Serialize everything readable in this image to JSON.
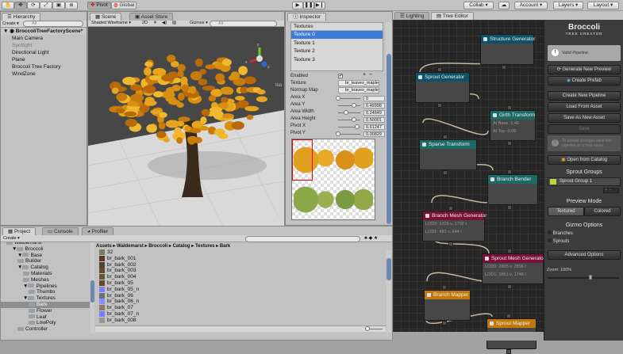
{
  "toolbar": {
    "tools": [
      "hand-tool",
      "move-tool",
      "rotate-tool",
      "scale-tool",
      "rect-tool",
      "transform-tool"
    ],
    "pivot": "Pivot",
    "global": "Global",
    "collab": "Collab ▾",
    "account": "Account ▾",
    "layers": "Layers ▾",
    "layout": "Layout ▾"
  },
  "hierarchy": {
    "tab": "Hierarchy",
    "create": "Create ▾",
    "search_placeholder": "All",
    "scene": "BroccoliTreeFactoryScene*",
    "items": [
      "Main Camera",
      "Spotlight",
      "Directional Light",
      "Plane",
      "Broccoli Tree Factory",
      "WindZone"
    ]
  },
  "scene": {
    "tab": "Scene",
    "asset_store_tab": "Asset Store",
    "shading": "Shaded Wireframe ▾",
    "mode_2d": "2D",
    "gizmos": "Gizmos ▾",
    "search_placeholder": "All",
    "iso": "Iso",
    "axes": {
      "x": "x",
      "y": "y",
      "z": "z"
    }
  },
  "inspector": {
    "tab": "Inspector",
    "list_header": "Textures",
    "textures": [
      "Texture 0",
      "Texture 1",
      "Texture 2",
      "Texture 3"
    ],
    "selected": 0,
    "fields": {
      "enabled": "Enabled",
      "texture": "Texture",
      "texture_val": "br_leaves_maple",
      "normal": "Normap Map",
      "normal_val": "br_leaves_maple"
    },
    "sliders": [
      {
        "label": "Area X",
        "value": "0",
        "frac": 0
      },
      {
        "label": "Area Y",
        "value": "0.49998",
        "frac": 0.5
      },
      {
        "label": "Area Width",
        "value": "0.24849",
        "frac": 0.25
      },
      {
        "label": "Area Height",
        "value": "0.50001",
        "frac": 0.5
      },
      {
        "label": "Pivot X",
        "value": "0.61247",
        "frac": 0.61
      },
      {
        "label": "Pivot Y",
        "value": "0.00829",
        "frac": 0.01
      }
    ]
  },
  "project": {
    "tabs": [
      "Project",
      "Console",
      "Profiler"
    ],
    "create": "Create ▾",
    "tree": [
      {
        "label": "Waldemarst",
        "d": 1
      },
      {
        "label": "Broccoli",
        "d": 2
      },
      {
        "label": "Base",
        "d": 3
      },
      {
        "label": "Builder",
        "d": 3
      },
      {
        "label": "Catalog",
        "d": 3
      },
      {
        "label": "Materials",
        "d": 4
      },
      {
        "label": "Meshes",
        "d": 4
      },
      {
        "label": "Pipelines",
        "d": 4
      },
      {
        "label": "Thumbs",
        "d": 5
      },
      {
        "label": "Textures",
        "d": 4
      },
      {
        "label": "Bark",
        "d": 5,
        "sel": true
      },
      {
        "label": "Flower",
        "d": 5
      },
      {
        "label": "Leaf",
        "d": 5
      },
      {
        "label": "LowPoly",
        "d": 5
      },
      {
        "label": "Controller",
        "d": 3
      }
    ],
    "breadcrumb": [
      "Assets",
      "Waldemarst",
      "Broccoli",
      "Catalog",
      "Textures",
      "Bark"
    ],
    "files": [
      {
        "name": "32",
        "c": "#7b7a5a"
      },
      {
        "name": "br_bark_001",
        "c": "#5a3a22"
      },
      {
        "name": "br_bark_002",
        "c": "#4a4540"
      },
      {
        "name": "br_bark_003",
        "c": "#6a4a2a"
      },
      {
        "name": "br_bark_004",
        "c": "#5a5a3a"
      },
      {
        "name": "br_bark_05",
        "c": "#6a4a20"
      },
      {
        "name": "br_bark_05_n",
        "c": "#8080ff"
      },
      {
        "name": "br_bark_06",
        "c": "#707070"
      },
      {
        "name": "br_bark_06_n",
        "c": "#8a8aff"
      },
      {
        "name": "br_bark_07",
        "c": "#8a7a60"
      },
      {
        "name": "br_bark_07_n",
        "c": "#7a7aff"
      },
      {
        "name": "br_bark_008",
        "c": "#9a9a8a"
      }
    ]
  },
  "tree_editor": {
    "tabs": [
      "Lighting",
      "Tree Editor"
    ],
    "nodes": [
      {
        "title": "Structure Generator",
        "color": "#0e5268",
        "lines": []
      },
      {
        "title": "Sprout Generator",
        "color": "#0e5268",
        "lines": []
      },
      {
        "title": "Girth Transform",
        "color": "#1b6a66",
        "lines": [
          "At Base :1.46",
          "At Top :0.05"
        ]
      },
      {
        "title": "Sparse Transform",
        "color": "#1b6a66",
        "lines": []
      },
      {
        "title": "Branch Bender",
        "color": "#1b6a66",
        "lines": []
      },
      {
        "title": "Branch Mesh Generator",
        "color": "#7a0f38",
        "lines": [
          "LOD0: 1225 v, 1792 t",
          "LOD1: 481 v, 644 t"
        ]
      },
      {
        "title": "Sprout Mesh Generator",
        "color": "#7a0f38",
        "lines": [
          "LOD0: 2605 v, 2896 t",
          "LOD1: 1861 v, 1748 t"
        ]
      },
      {
        "title": "Branch Mapper",
        "color": "#c27808",
        "lines": []
      },
      {
        "title": "Sprout Mapper",
        "color": "#c27808",
        "lines": []
      }
    ]
  },
  "sidepanel": {
    "logo": "Broccoli",
    "logo_sub": "TREE CREATOR",
    "status": "Valid Pipeline.",
    "generate": "Generate New Preview",
    "create_prefab": "Create Prefab",
    "create_pipeline": "Create New Pipeline",
    "load": "Load From Asset",
    "save_as": "Save As New Asset",
    "save": "Save",
    "persist_note": "To persist changes save this pipeline as a new asset.",
    "open_catalog": "Open from Catalog",
    "sprout_groups": "Sprout Groups",
    "sprout_group_1": "Sprout Group 1",
    "sprout_group_color": "#b8d838",
    "preview_mode": "Preview Mode",
    "textured": "Textured",
    "colored": "Colored",
    "gizmo_options": "Gizmo Options",
    "branches": "Branches",
    "sprouts": "Sprouts",
    "advanced": "Advanced Options",
    "zoom": "Zoom: 100%",
    "zoom_frac": 0.6
  }
}
